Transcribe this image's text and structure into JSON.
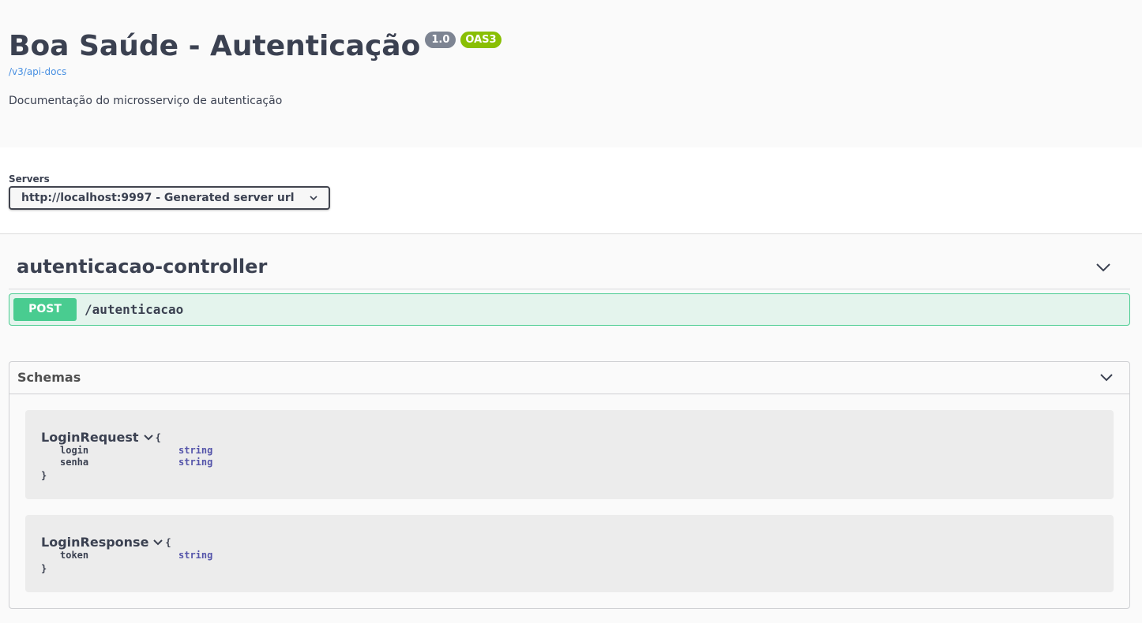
{
  "info": {
    "title": "Boa Saúde - Autenticação",
    "version": "1.0",
    "oas_badge": "OAS3",
    "spec_url": "/v3/api-docs",
    "description": "Documentação do microsserviço de autenticação"
  },
  "servers": {
    "label": "Servers",
    "selected": "http://localhost:9997 - Generated server url"
  },
  "tag": {
    "name": "autenticacao-controller",
    "operations": [
      {
        "method": "POST",
        "path": "/autenticacao"
      }
    ]
  },
  "schemas": {
    "title": "Schemas",
    "models": [
      {
        "name": "LoginRequest",
        "open_brace": "{",
        "close_brace": "}",
        "properties": [
          {
            "name": "login",
            "type": "string"
          },
          {
            "name": "senha",
            "type": "string"
          }
        ]
      },
      {
        "name": "LoginResponse",
        "open_brace": "{",
        "close_brace": "}",
        "properties": [
          {
            "name": "token",
            "type": "string"
          }
        ]
      }
    ]
  },
  "colors": {
    "post_green": "#49cc90",
    "link_blue": "#4990e2",
    "oas_badge_green": "#89bf04",
    "version_badge_gray": "#7d8492",
    "type_purple": "#55a"
  }
}
